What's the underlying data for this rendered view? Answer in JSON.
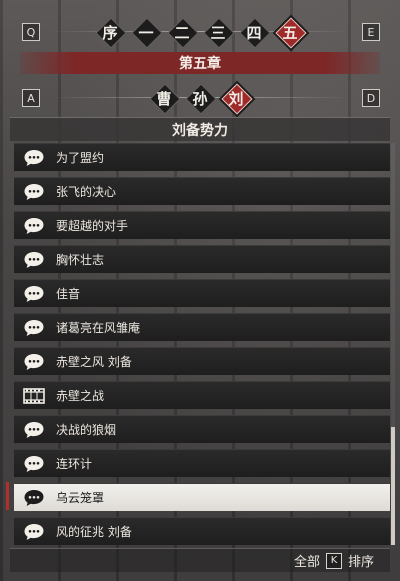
{
  "keys": {
    "chapter_prev": "Q",
    "chapter_next": "E",
    "faction_prev": "A",
    "faction_next": "D",
    "sort": "K"
  },
  "chapters": {
    "tabs": [
      {
        "label": "序",
        "active": false
      },
      {
        "label": "一",
        "active": false
      },
      {
        "label": "二",
        "active": false
      },
      {
        "label": "三",
        "active": false
      },
      {
        "label": "四",
        "active": false
      },
      {
        "label": "五",
        "active": true
      }
    ],
    "title": "第五章"
  },
  "factions": {
    "tabs": [
      {
        "label": "曹",
        "active": false
      },
      {
        "label": "孙",
        "active": false
      },
      {
        "label": "刘",
        "active": true
      }
    ],
    "list_title": "刘备势力"
  },
  "events": [
    {
      "label": "为了盟约",
      "icon": "chat-bubble-icon",
      "selected": false
    },
    {
      "label": "张飞的决心",
      "icon": "chat-bubble-icon",
      "selected": false
    },
    {
      "label": "要超越的对手",
      "icon": "chat-bubble-icon",
      "selected": false
    },
    {
      "label": "胸怀壮志",
      "icon": "chat-bubble-icon",
      "selected": false
    },
    {
      "label": "佳音",
      "icon": "chat-bubble-icon",
      "selected": false
    },
    {
      "label": "诸葛亮在风雏庵",
      "icon": "chat-bubble-icon",
      "selected": false
    },
    {
      "label": "赤壁之风 刘备",
      "icon": "chat-bubble-icon",
      "selected": false
    },
    {
      "label": "赤壁之战",
      "icon": "film-strip-icon",
      "selected": false
    },
    {
      "label": "决战的狼烟",
      "icon": "chat-bubble-icon",
      "selected": false
    },
    {
      "label": "连环计",
      "icon": "chat-bubble-icon",
      "selected": false
    },
    {
      "label": "乌云笼罩",
      "icon": "chat-bubble-icon",
      "selected": true
    },
    {
      "label": "风的征兆 刘备",
      "icon": "chat-bubble-icon",
      "selected": false
    }
  ],
  "footer": {
    "filter_label": "全部",
    "sort_label": "排序"
  },
  "colors": {
    "accent_red": "#a02a2a",
    "banner_red": "#7d2727",
    "row_dark": "#242323",
    "row_selected": "#eceae6"
  }
}
